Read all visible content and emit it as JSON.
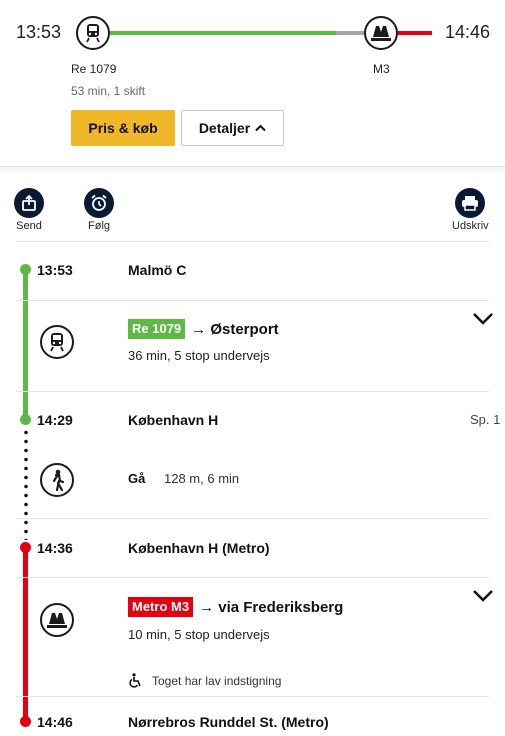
{
  "summary": {
    "departure_time": "13:53",
    "arrival_time": "14:46",
    "train_label": "Re 1079",
    "metro_label": "M3",
    "duration": "53 min, 1 skift",
    "buy_button": "Pris & køb",
    "details_button": "Detaljer"
  },
  "actions": {
    "send": "Send",
    "follow": "Følg",
    "print": "Udskriv"
  },
  "stops": [
    {
      "time": "13:53",
      "name": "Malmö C",
      "platform": ""
    },
    {
      "time": "14:29",
      "name": "København H",
      "platform": "Sp. 1"
    },
    {
      "time": "14:36",
      "name": "København H (Metro)",
      "platform": ""
    },
    {
      "time": "14:46",
      "name": "Nørrebros Runddel St. (Metro)",
      "platform": ""
    }
  ],
  "legs": {
    "train": {
      "badge": "Re 1079",
      "destination": "→ Østerport",
      "info": "36 min, 5 stop undervejs"
    },
    "walk": {
      "label": "Gå",
      "info": "128 m, 6 min"
    },
    "metro": {
      "badge": "Metro M3",
      "destination": "→ via Frederiksberg",
      "info": "10 min, 5 stop undervejs",
      "accessibility": "Toget har lav indstigning"
    }
  },
  "colors": {
    "train": "#5cb946",
    "metro": "#e5000f",
    "buy": "#f0b829",
    "icon_dark": "#0a1a33"
  },
  "icons": [
    "train-icon",
    "metro-icon",
    "share-icon",
    "alarm-clock-icon",
    "printer-icon",
    "walk-icon",
    "wheelchair-icon",
    "chevron-down-icon",
    "chevron-up-icon"
  ]
}
